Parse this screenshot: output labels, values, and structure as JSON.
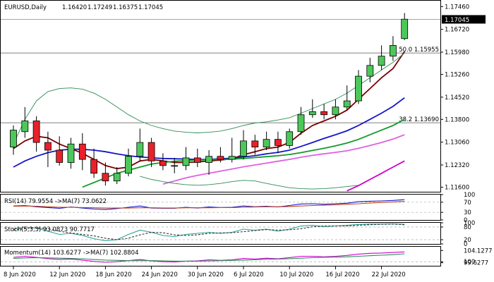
{
  "chart_data": [
    {
      "type": "candlestick",
      "panel": "main",
      "title": "EURUSD,Daily",
      "ohlc_header": [
        "1.16420",
        "1.17249",
        "1.16375",
        "1.17045"
      ],
      "ylim": [
        1.1145,
        1.1765
      ],
      "y_ticks": [
        "1.17460",
        "1.16720",
        "1.15980",
        "1.15260",
        "1.14520",
        "1.13800",
        "1.13060",
        "1.12320",
        "1.11600"
      ],
      "y_tick_values": [
        1.1746,
        1.1672,
        1.1598,
        1.1526,
        1.1452,
        1.138,
        1.1306,
        1.1232,
        1.116
      ],
      "x_ticks": [
        "8 Jun 2020",
        "12 Jun 2020",
        "18 Jun 2020",
        "24 Jun 2020",
        "30 Jun 2020",
        "6 Jul 2020",
        "10 Jul 2020",
        "16 Jul 2020",
        "22 Jul 2020"
      ],
      "x_tick_index": [
        0,
        4,
        8,
        12,
        16,
        20,
        24,
        28,
        32
      ],
      "current_price": {
        "label": "1.17045",
        "value": 1.17045
      },
      "levels": [
        {
          "label": "50.0 1.15955",
          "value": 1.15955
        },
        {
          "label": "38.2 1.13690",
          "value": 1.1369
        }
      ],
      "bull_color": "#4cc85a",
      "bear_color": "#e8212b",
      "candles": [
        [
          1.129,
          1.136,
          1.1265,
          1.1345
        ],
        [
          1.134,
          1.142,
          1.132,
          1.1375
        ],
        [
          1.1375,
          1.139,
          1.1275,
          1.1305
        ],
        [
          1.1305,
          1.134,
          1.1225,
          1.128
        ],
        [
          1.128,
          1.1325,
          1.123,
          1.124
        ],
        [
          1.124,
          1.132,
          1.122,
          1.13
        ],
        [
          1.13,
          1.1335,
          1.1215,
          1.125
        ],
        [
          1.125,
          1.1285,
          1.119,
          1.1205
        ],
        [
          1.1205,
          1.124,
          1.1165,
          1.118
        ],
        [
          1.118,
          1.1225,
          1.117,
          1.1205
        ],
        [
          1.1205,
          1.1285,
          1.1195,
          1.126
        ],
        [
          1.126,
          1.135,
          1.1245,
          1.1305
        ],
        [
          1.1305,
          1.132,
          1.1225,
          1.1245
        ],
        [
          1.1245,
          1.127,
          1.1215,
          1.123
        ],
        [
          1.123,
          1.1255,
          1.1205,
          1.123
        ],
        [
          1.123,
          1.129,
          1.1215,
          1.1255
        ],
        [
          1.1255,
          1.1285,
          1.1225,
          1.124
        ],
        [
          1.124,
          1.128,
          1.12,
          1.126
        ],
        [
          1.126,
          1.129,
          1.124,
          1.125
        ],
        [
          1.125,
          1.132,
          1.124,
          1.126
        ],
        [
          1.126,
          1.1345,
          1.125,
          1.131
        ],
        [
          1.131,
          1.133,
          1.1265,
          1.129
        ],
        [
          1.129,
          1.134,
          1.128,
          1.1315
        ],
        [
          1.1315,
          1.134,
          1.127,
          1.1295
        ],
        [
          1.1295,
          1.135,
          1.1285,
          1.134
        ],
        [
          1.134,
          1.142,
          1.133,
          1.1395
        ],
        [
          1.1395,
          1.1445,
          1.1385,
          1.1405
        ],
        [
          1.1405,
          1.143,
          1.138,
          1.1395
        ],
        [
          1.1395,
          1.1445,
          1.138,
          1.142
        ],
        [
          1.142,
          1.149,
          1.141,
          1.144
        ],
        [
          1.144,
          1.154,
          1.143,
          1.152
        ],
        [
          1.152,
          1.158,
          1.15,
          1.1555
        ],
        [
          1.1555,
          1.162,
          1.154,
          1.1585
        ],
        [
          1.1585,
          1.165,
          1.157,
          1.162
        ],
        [
          1.1642,
          1.1725,
          1.1637,
          1.1705
        ]
      ],
      "overlays": [
        {
          "color": "#7a0000",
          "values": [
            1.1285,
            1.131,
            1.1325,
            1.132,
            1.13,
            1.1285,
            1.127,
            1.125,
            1.123,
            1.122,
            1.1225,
            1.1245,
            1.125,
            1.1245,
            1.124,
            1.124,
            1.1242,
            1.1245,
            1.1248,
            1.1252,
            1.1265,
            1.1275,
            1.1285,
            1.129,
            1.1305,
            1.1335,
            1.136,
            1.1375,
            1.139,
            1.141,
            1.1445,
            1.148,
            1.1515,
            1.1545,
            1.16
          ]
        },
        {
          "color": "#1515c8",
          "values": [
            1.1225,
            1.1245,
            1.126,
            1.1272,
            1.128,
            1.1283,
            1.1283,
            1.128,
            1.1275,
            1.1268,
            1.1262,
            1.1258,
            1.1255,
            1.1253,
            1.1252,
            1.1251,
            1.125,
            1.125,
            1.1252,
            1.1254,
            1.1258,
            1.1262,
            1.1268,
            1.1273,
            1.128,
            1.1292,
            1.1305,
            1.1318,
            1.133,
            1.1343,
            1.136,
            1.138,
            1.14,
            1.1422,
            1.145
          ]
        },
        {
          "color": "#0f9a2a",
          "values": [
            null,
            null,
            null,
            null,
            null,
            null,
            1.116,
            1.1175,
            1.119,
            1.1205,
            1.1215,
            1.1225,
            1.1235,
            1.124,
            1.1244,
            1.1246,
            1.1248,
            1.1249,
            1.125,
            1.1251,
            1.1253,
            1.1256,
            1.1259,
            1.1262,
            1.1266,
            1.1272,
            1.1279,
            1.1286,
            1.1294,
            1.1303,
            1.1315,
            1.133,
            1.1345,
            1.136,
            1.138
          ]
        },
        {
          "color": "#e060e0",
          "values": [
            null,
            null,
            null,
            null,
            null,
            null,
            null,
            null,
            null,
            null,
            null,
            null,
            null,
            1.117,
            1.118,
            1.119,
            1.1198,
            1.1205,
            1.1212,
            1.1219,
            1.1226,
            1.1232,
            1.1238,
            1.1244,
            1.125,
            1.1257,
            1.1263,
            1.1268,
            1.1273,
            1.1278,
            1.1286,
            1.1295,
            1.1305,
            1.1316,
            1.133
          ]
        },
        {
          "color": "#cc00cc",
          "values": [
            null,
            null,
            null,
            null,
            null,
            null,
            null,
            null,
            null,
            null,
            null,
            null,
            null,
            null,
            null,
            null,
            null,
            null,
            null,
            null,
            null,
            null,
            null,
            null,
            null,
            null,
            null,
            null,
            null,
            1.1148,
            1.1165,
            1.1185,
            1.1205,
            1.1225,
            1.1245
          ]
        },
        {
          "color": "#2e8b57",
          "values": [
            1.13,
            1.138,
            1.144,
            1.147,
            1.148,
            1.1482,
            1.1478,
            1.1465,
            1.1445,
            1.142,
            1.1395,
            1.1375,
            1.136,
            1.135,
            1.1342,
            1.1338,
            1.1336,
            1.1338,
            1.1342,
            1.135,
            1.136,
            1.1368,
            1.1372,
            1.1378,
            1.1385,
            1.14,
            1.1415,
            1.143,
            1.1445,
            1.1465,
            1.149,
            1.1515,
            1.154,
            1.1565,
            1.1595
          ]
        },
        {
          "color": "#2e8b57",
          "values": [
            null,
            null,
            null,
            null,
            null,
            null,
            null,
            null,
            null,
            null,
            null,
            1.1195,
            1.1185,
            1.1178,
            1.1172,
            1.1168,
            1.1166,
            1.1168,
            1.1172,
            1.1178,
            1.1182,
            1.118,
            1.1172,
            1.1165,
            1.1158,
            1.1155,
            1.1154,
            1.1155,
            1.1158,
            1.1162,
            1.1166,
            null,
            null,
            null,
            null
          ]
        }
      ]
    },
    {
      "type": "line",
      "panel": "rsi",
      "title": "RSI(14) 79.9554 ->MA(7) 73.0622",
      "ylim": [
        0,
        100
      ],
      "y_ticks": [
        "100",
        "70",
        "30",
        "0"
      ],
      "y_tick_values": [
        100,
        70,
        30,
        0
      ],
      "series": [
        {
          "color": "#1515c8",
          "values": [
            55,
            57,
            52,
            49,
            46,
            51,
            47,
            43,
            41,
            45,
            50,
            55,
            47,
            46,
            46,
            50,
            47,
            51,
            49,
            50,
            55,
            52,
            54,
            51,
            57,
            63,
            64,
            62,
            64,
            66,
            72,
            74,
            75,
            77,
            80
          ]
        },
        {
          "color": "#c04020",
          "values": [
            54,
            55,
            54,
            52,
            50,
            50,
            49,
            48,
            47,
            47,
            47,
            48,
            48,
            47,
            47,
            48,
            48,
            48,
            49,
            49,
            50,
            51,
            52,
            52,
            53,
            55,
            57,
            58,
            60,
            62,
            64,
            67,
            69,
            71,
            73
          ]
        }
      ]
    },
    {
      "type": "line",
      "panel": "stoch",
      "title": "Stoch(5,3,3) 93.0873 90.7717",
      "ylim": [
        0,
        100
      ],
      "y_ticks": [
        "100",
        "80",
        "20",
        "0"
      ],
      "y_tick_values": [
        100,
        80,
        20,
        0
      ],
      "series": [
        {
          "color": "#2aa198",
          "values": [
            70,
            80,
            75,
            60,
            45,
            50,
            40,
            25,
            15,
            20,
            45,
            65,
            55,
            40,
            35,
            45,
            50,
            55,
            50,
            55,
            70,
            65,
            70,
            60,
            70,
            85,
            88,
            82,
            85,
            88,
            92,
            94,
            94,
            95,
            93
          ]
        },
        {
          "color": "#333333",
          "values": [
            65,
            72,
            76,
            72,
            60,
            52,
            45,
            38,
            27,
            20,
            27,
            43,
            55,
            53,
            43,
            40,
            43,
            50,
            52,
            53,
            58,
            63,
            68,
            65,
            67,
            72,
            81,
            85,
            85,
            85,
            88,
            91,
            93,
            94,
            91
          ]
        }
      ]
    },
    {
      "type": "line",
      "panel": "momentum",
      "title": "Momentum(14) 103.6277 ->MA(7) 102.8804",
      "ylim": [
        98.5,
        105.5
      ],
      "y_ticks": [
        "104.1277",
        "100",
        "99.6277"
      ],
      "y_tick_values": [
        104.1277,
        100,
        99.6277
      ],
      "series": [
        {
          "color": "#cc00cc",
          "values": [
            101.6,
            102.0,
            101.6,
            101.1,
            100.8,
            101.0,
            100.6,
            100.1,
            99.8,
            100.0,
            100.4,
            100.8,
            100.3,
            100.0,
            99.9,
            100.2,
            100.3,
            100.7,
            100.5,
            100.7,
            101.2,
            101.0,
            101.3,
            101.1,
            101.5,
            102.0,
            102.0,
            101.8,
            102.0,
            102.3,
            102.8,
            103.1,
            103.2,
            103.4,
            103.6
          ]
        },
        {
          "color": "#2e8b57",
          "values": [
            101.2,
            101.4,
            101.5,
            101.4,
            101.3,
            101.2,
            101.1,
            100.8,
            100.6,
            100.5,
            100.4,
            100.4,
            100.4,
            100.3,
            100.2,
            100.2,
            100.2,
            100.3,
            100.4,
            100.5,
            100.6,
            100.7,
            100.9,
            101.0,
            101.1,
            101.3,
            101.5,
            101.6,
            101.7,
            101.8,
            102.0,
            102.2,
            102.4,
            102.6,
            102.9
          ]
        }
      ]
    }
  ]
}
